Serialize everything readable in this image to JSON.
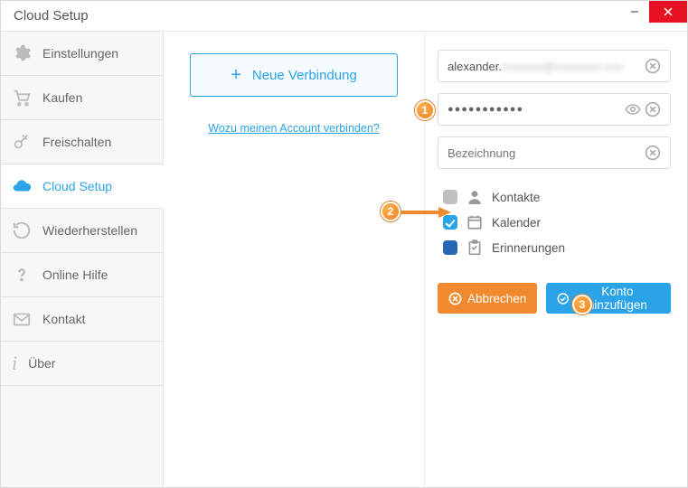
{
  "window": {
    "title": "Cloud Setup"
  },
  "sidebar": {
    "items": [
      {
        "label": "Einstellungen",
        "icon": "gear"
      },
      {
        "label": "Kaufen",
        "icon": "cart"
      },
      {
        "label": "Freischalten",
        "icon": "key"
      },
      {
        "label": "Cloud Setup",
        "icon": "cloud",
        "active": true
      },
      {
        "label": "Wiederherstellen",
        "icon": "restore"
      },
      {
        "label": "Online Hilfe",
        "icon": "help"
      },
      {
        "label": "Kontakt",
        "icon": "mail"
      },
      {
        "label": "Über",
        "icon": "info"
      }
    ]
  },
  "mid": {
    "new_connection": "Neue Verbindung",
    "help_link": "Wozu meinen Account verbinden?"
  },
  "form": {
    "email_visible_prefix": "alexander.",
    "email_blurred_suffix": "xxxxxxx@xxxxxxxx.xxx",
    "password_mask": "●●●●●●●●●●●",
    "label_placeholder": "Bezeichnung"
  },
  "sync": {
    "items": [
      {
        "label": "Kontakte",
        "checked": false,
        "style": "off",
        "icon": "person"
      },
      {
        "label": "Kalender",
        "checked": true,
        "style": "blue",
        "icon": "calendar"
      },
      {
        "label": "Erinnerungen",
        "checked": true,
        "style": "solid",
        "icon": "clipboard"
      }
    ]
  },
  "buttons": {
    "cancel": "Abbrechen",
    "add": "Konto hinzufügen"
  },
  "markers": [
    "1",
    "2",
    "3"
  ]
}
